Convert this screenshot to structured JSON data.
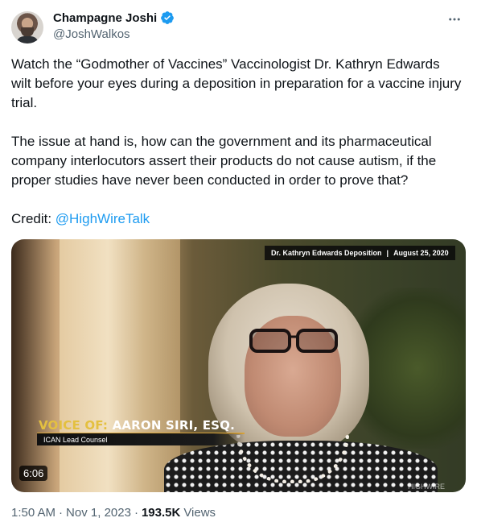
{
  "author": {
    "name": "Champagne Joshi",
    "handle": "@JoshWalkos",
    "verified": true
  },
  "tweet": {
    "paragraph1": "Watch the “Godmother of Vaccines” Vaccinologist Dr. Kathryn Edwards wilt before your eyes during a deposition in preparation for a vaccine injury trial.",
    "paragraph2": "The issue at hand is, how can the government and its pharmaceutical company interlocutors assert their products do not cause autism, if the proper studies have never been conducted in order to prove that?",
    "credit_prefix": "Credit: ",
    "credit_link": "@HighWireTalk"
  },
  "video": {
    "top_caption_left": "Dr. Kathryn Edwards Deposition",
    "top_caption_sep": "|",
    "top_caption_right": "August 25, 2020",
    "lower_third_prefix": "VOICE OF:",
    "lower_third_name": " AARON SIRI, ESQ.",
    "lower_third_subtitle": "ICAN Lead Counsel",
    "watermark": "HIGHWIRE",
    "duration": "6:06"
  },
  "meta": {
    "time": "1:50 AM",
    "dot1": "·",
    "date": "Nov 1, 2023",
    "dot2": "·",
    "views_count": "193.5K",
    "views_label": "Views"
  },
  "colors": {
    "link": "#1d9bf0",
    "verified": "#1d9bf0",
    "secondary_text": "#536471"
  },
  "icons": {
    "verified": "verified-badge-icon",
    "more": "more-options-icon"
  }
}
